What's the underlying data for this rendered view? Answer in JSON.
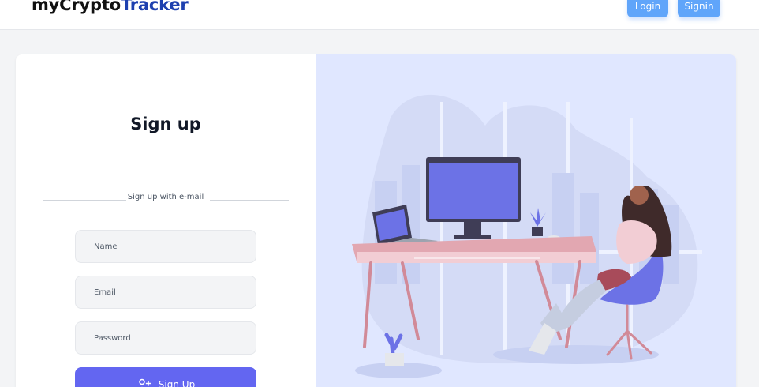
{
  "header": {
    "brand_part1": "myCrypto",
    "brand_part2": "Tracker",
    "login_label": "Login",
    "signin_label": "Signin"
  },
  "form": {
    "title": "Sign up",
    "divider_text": "Sign up with e-mail",
    "name_placeholder": "Name",
    "email_placeholder": "Email",
    "password_placeholder": "Password",
    "submit_label": "Sign Up"
  },
  "colors": {
    "brand_accent": "#1e40af",
    "nav_button": "#60a5fa",
    "primary_button": "#6366f1",
    "illustration_bg": "#e0e7ff"
  },
  "icons": {
    "submit": "user-plus-icon"
  }
}
